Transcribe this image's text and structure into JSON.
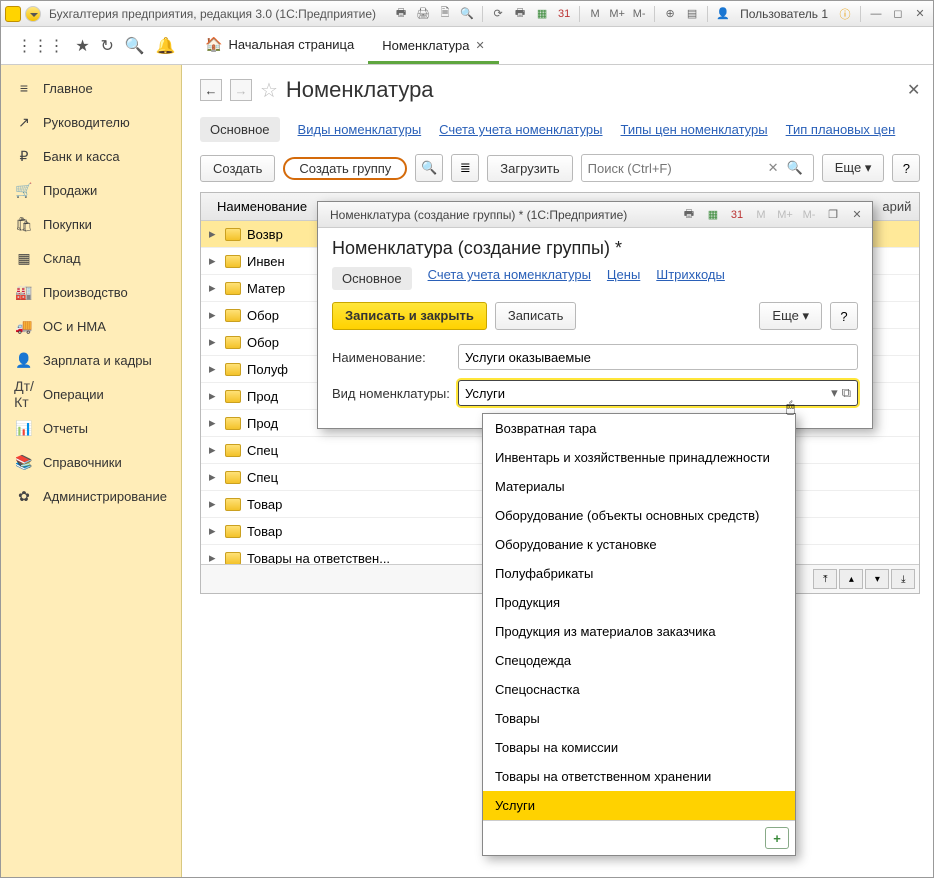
{
  "titlebar": {
    "title": "Бухгалтерия предприятия, редакция 3.0  (1С:Предприятие)",
    "user": "Пользователь 1",
    "btns": {
      "m": "M",
      "mplus": "M+",
      "mminus": "M-"
    }
  },
  "tabs": {
    "home_label": "Начальная страница",
    "active": {
      "label": "Номенклатура"
    }
  },
  "sidebar": {
    "items": [
      {
        "label": "Главное",
        "icon": "≡"
      },
      {
        "label": "Руководителю",
        "icon": "↗"
      },
      {
        "label": "Банк и касса",
        "icon": "₽"
      },
      {
        "label": "Продажи",
        "icon": "🛒"
      },
      {
        "label": "Покупки",
        "icon": "🛍"
      },
      {
        "label": "Склад",
        "icon": "▦"
      },
      {
        "label": "Производство",
        "icon": "🏭"
      },
      {
        "label": "ОС и НМА",
        "icon": "🚚"
      },
      {
        "label": "Зарплата и кадры",
        "icon": "👤"
      },
      {
        "label": "Операции",
        "icon": "Дт/Кт"
      },
      {
        "label": "Отчеты",
        "icon": "📊"
      },
      {
        "label": "Справочники",
        "icon": "📚"
      },
      {
        "label": "Администрирование",
        "icon": "✿"
      }
    ]
  },
  "page": {
    "title": "Номенклатура",
    "subnav": [
      "Основное",
      "Виды номенклатуры",
      "Счета учета номенклатуры",
      "Типы цен номенклатуры",
      "Тип плановых цен"
    ],
    "buttons": {
      "create": "Создать",
      "create_group": "Создать группу",
      "load": "Загрузить",
      "more": "Еще",
      "search_placeholder": "Поиск (Ctrl+F)"
    },
    "list_header": "Наименование",
    "rows": [
      "Возвр",
      "Инвен",
      "Матер",
      "Обор",
      "Обор",
      "Полуф",
      "Прод",
      "Прод",
      "Спец",
      "Спец",
      "Товар",
      "Товар",
      "Товары на ответствен..."
    ],
    "last_col": "арий"
  },
  "modal": {
    "titlebar": "Номенклатура (создание группы) * (1С:Предприятие)",
    "title": "Номенклатура (создание группы) *",
    "subnav": [
      "Основное",
      "Счета учета номенклатуры",
      "Цены",
      "Штрихкоды"
    ],
    "btns": {
      "save_close": "Записать и закрыть",
      "save": "Записать",
      "more": "Еще"
    },
    "fields": {
      "name_label": "Наименование:",
      "name_value": "Услуги оказываемые",
      "type_label": "Вид номенклатуры:",
      "type_value": "Услуги"
    }
  },
  "dropdown": {
    "items": [
      "Возвратная тара",
      "Инвентарь и хозяйственные принадлежности",
      "Материалы",
      "Оборудование (объекты основных средств)",
      "Оборудование к установке",
      "Полуфабрикаты",
      "Продукция",
      "Продукция из материалов заказчика",
      "Спецодежда",
      "Спецоснастка",
      "Товары",
      "Товары на комиссии",
      "Товары на ответственном хранении",
      "Услуги"
    ],
    "selected": "Услуги"
  }
}
